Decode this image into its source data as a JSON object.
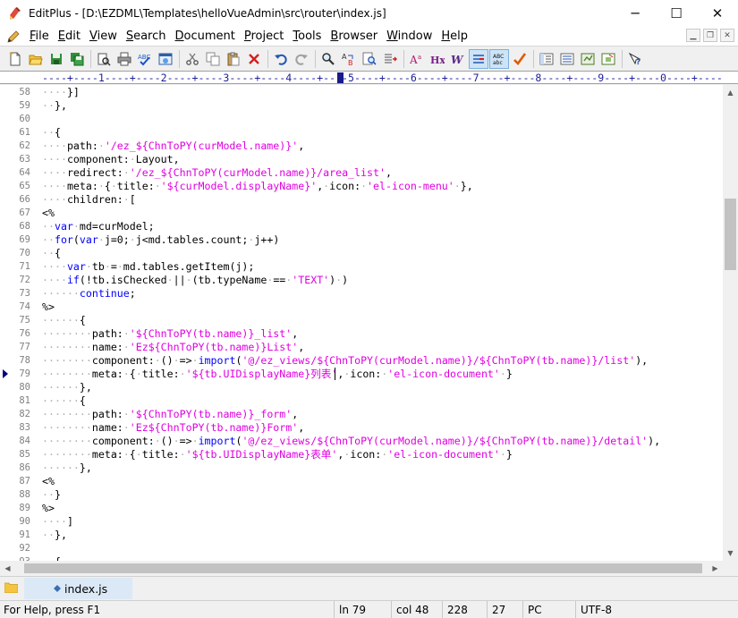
{
  "window": {
    "title": "EditPlus - [D:\\EZDML\\Templates\\helloVueAdmin\\src\\router\\index.js]",
    "minimize": "─",
    "maximize": "☐",
    "close": "✕"
  },
  "menu": {
    "items": [
      {
        "label": "File",
        "key": "F"
      },
      {
        "label": "Edit",
        "key": "E"
      },
      {
        "label": "View",
        "key": "V"
      },
      {
        "label": "Search",
        "key": "S"
      },
      {
        "label": "Document",
        "key": "D"
      },
      {
        "label": "Project",
        "key": "P"
      },
      {
        "label": "Tools",
        "key": "T"
      },
      {
        "label": "Browser",
        "key": "B"
      },
      {
        "label": "Window",
        "key": "W"
      },
      {
        "label": "Help",
        "key": "H"
      }
    ]
  },
  "toolbar": {
    "buttons": [
      "new-file-icon",
      "open-folder-icon",
      "save-icon",
      "save-all-icon",
      "print-preview-icon",
      "print-icon",
      "spell-check-icon",
      "browser-preview-icon",
      "cut-icon",
      "copy-icon",
      "paste-icon",
      "delete-icon",
      "undo-icon",
      "redo-icon",
      "find-icon",
      "replace-icon",
      "find-in-files-icon",
      "goto-line-icon",
      "font-icon",
      "hx-tag-icon",
      "word-wrap-icon",
      "line-number-icon",
      "column-ruler-icon",
      "check-icon",
      "outline-icon",
      "list-icon",
      "cliptext-icon",
      "directory-icon",
      "help-icon"
    ]
  },
  "ruler": {
    "text": "----+----1----+----2----+----3----+----4----+----5----+----6----+----7----+----8----+----9----+----0----+----"
  },
  "editor": {
    "lines": [
      {
        "n": "58",
        "t": "    }]"
      },
      {
        "n": "59",
        "t": "  },"
      },
      {
        "n": "60",
        "t": ""
      },
      {
        "n": "61",
        "t": "  {"
      },
      {
        "n": "62",
        "t": "    path: '/ez_${ChnToPY(curModel.name)}',"
      },
      {
        "n": "63",
        "t": "    component: Layout,"
      },
      {
        "n": "64",
        "t": "    redirect: '/ez_${ChnToPY(curModel.name)}/area_list',"
      },
      {
        "n": "65",
        "t": "    meta: { title: '${curModel.displayName}', icon: 'el-icon-menu' },"
      },
      {
        "n": "66",
        "t": "    children: ["
      },
      {
        "n": "67",
        "t": "<%"
      },
      {
        "n": "68",
        "t": "  var md=curModel;"
      },
      {
        "n": "69",
        "t": "  for(var j=0; j<md.tables.count; j++)"
      },
      {
        "n": "70",
        "t": "  {"
      },
      {
        "n": "71",
        "t": "    var tb = md.tables.getItem(j);"
      },
      {
        "n": "72",
        "t": "    if(!tb.isChecked || (tb.typeName == 'TEXT') )"
      },
      {
        "n": "73",
        "t": "      continue;"
      },
      {
        "n": "74",
        "t": "%>"
      },
      {
        "n": "75",
        "t": "      {"
      },
      {
        "n": "76",
        "t": "        path: '${ChnToPY(tb.name)}_list',"
      },
      {
        "n": "77",
        "t": "        name: 'Ez${ChnToPY(tb.name)}List',"
      },
      {
        "n": "78",
        "t": "        component: () => import('@/ez_views/${ChnToPY(curModel.name)}/${ChnToPY(tb.name)}/list'),"
      },
      {
        "n": "79",
        "t": "        meta: { title: '${tb.UIDisplayName}列表', icon: 'el-icon-document' }"
      },
      {
        "n": "80",
        "t": "      },"
      },
      {
        "n": "81",
        "t": "      {"
      },
      {
        "n": "82",
        "t": "        path: '${ChnToPY(tb.name)}_form',"
      },
      {
        "n": "83",
        "t": "        name: 'Ez${ChnToPY(tb.name)}Form',"
      },
      {
        "n": "84",
        "t": "        component: () => import('@/ez_views/${ChnToPY(curModel.name)}/${ChnToPY(tb.name)}/detail'),"
      },
      {
        "n": "85",
        "t": "        meta: { title: '${tb.UIDisplayName}表单', icon: 'el-icon-document' }"
      },
      {
        "n": "86",
        "t": "      },"
      },
      {
        "n": "87",
        "t": "<%"
      },
      {
        "n": "88",
        "t": "  }"
      },
      {
        "n": "89",
        "t": "%>"
      },
      {
        "n": "90",
        "t": "    ]"
      },
      {
        "n": "91",
        "t": "  },"
      },
      {
        "n": "92",
        "t": ""
      },
      {
        "n": "93",
        "t": "  {"
      }
    ]
  },
  "tabs": [
    {
      "label": "index.js",
      "active": true
    }
  ],
  "status": {
    "help": "For Help, press F1",
    "line": "ln 79",
    "col": "col 48",
    "total": "228",
    "chars": "27",
    "mode": "PC",
    "encoding": "UTF-8"
  },
  "colors": {
    "keyword": "#0000ff",
    "string": "#e000e0",
    "whitespace": "#b0b0b0",
    "line_number": "#808080",
    "ruler": "#1e1e9c"
  }
}
